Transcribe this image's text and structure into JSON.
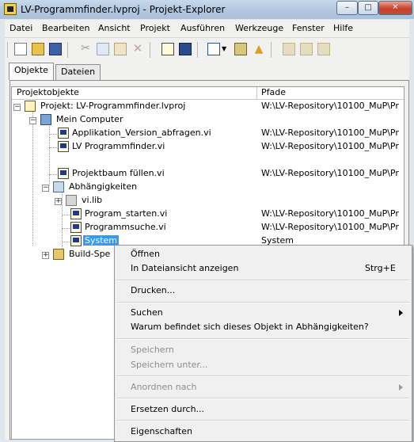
{
  "window": {
    "title": "LV-Programmfinder.lvproj - Projekt-Explorer",
    "controls": {
      "minimize": "–",
      "maximize": "□",
      "close": "✕"
    }
  },
  "menubar": [
    "Datei",
    "Bearbeiten",
    "Ansicht",
    "Projekt",
    "Ausführen",
    "Werkzeuge",
    "Fenster",
    "Hilfe"
  ],
  "toolbar": {
    "icons": [
      "new-icon",
      "open-icon",
      "save-all-icon",
      "cut-icon",
      "copy-icon",
      "paste-icon",
      "delete-icon",
      "build-icon",
      "build-spec-icon",
      "view-icon",
      "dropdown-icon",
      "resolve-icon",
      "warning-icon",
      "source-control-icon",
      "source-control-2-icon",
      "source-control-3-icon"
    ]
  },
  "tabs": [
    "Objekte",
    "Dateien"
  ],
  "tree": {
    "columns": {
      "items": "Projektobjekte",
      "paths": "Pfade"
    },
    "rows": [
      {
        "label": "Projekt: LV-Programmfinder.lvproj",
        "path": "W:\\LV-Repository\\10100_MuP\\Pr"
      },
      {
        "label": "Mein Computer",
        "path": ""
      },
      {
        "label": "Applikation_Version_abfragen.vi",
        "path": "W:\\LV-Repository\\10100_MuP\\Pr"
      },
      {
        "label": "LV Programmfinder.vi",
        "path": "W:\\LV-Repository\\10100_MuP\\Pr"
      },
      {
        "label": "Projektbaum füllen.vi",
        "path": "W:\\LV-Repository\\10100_MuP\\Pr"
      },
      {
        "label": "Abhängigkeiten",
        "path": ""
      },
      {
        "label": "vi.lib",
        "path": ""
      },
      {
        "label": "Program_starten.vi",
        "path": "W:\\LV-Repository\\10100_MuP\\Pr"
      },
      {
        "label": "Programmsuche.vi",
        "path": "W:\\LV-Repository\\10100_MuP\\Pr"
      },
      {
        "label": "System",
        "path": "System"
      },
      {
        "label": "Build-Spe",
        "path": ""
      }
    ]
  },
  "context_menu": {
    "open": "Öffnen",
    "show_in_files": "In Dateiansicht anzeigen",
    "show_in_files_shortcut": "Strg+E",
    "print": "Drucken...",
    "find": "Suchen",
    "why_in_dependencies": "Warum befindet sich dieses Objekt in Abhängigkeiten?",
    "save": "Speichern",
    "save_as": "Speichern unter...",
    "arrange_by": "Anordnen nach",
    "replace_with": "Ersetzen durch...",
    "properties": "Eigenschaften"
  }
}
